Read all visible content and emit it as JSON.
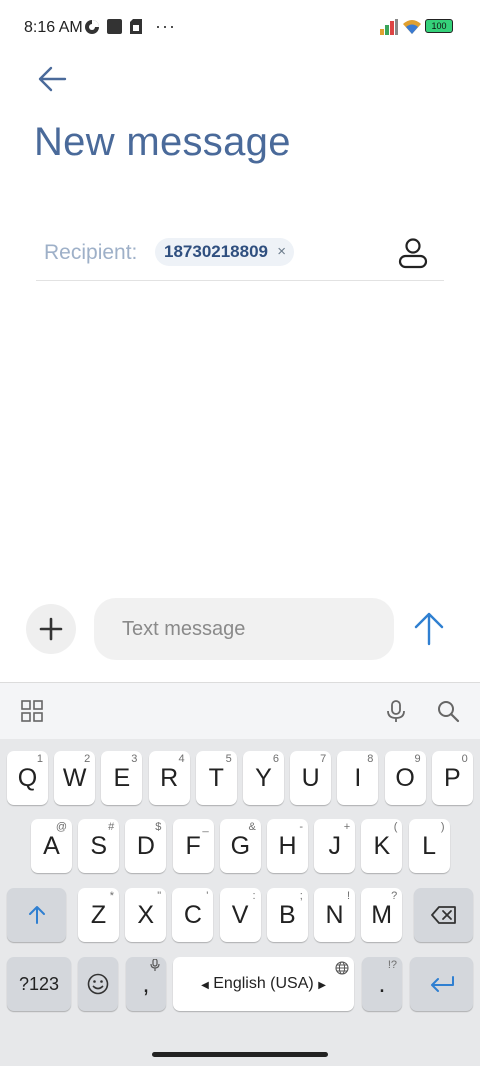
{
  "status_bar": {
    "time": "8:16 AM",
    "battery": "100",
    "more": "···"
  },
  "header": {
    "title": "New message"
  },
  "recipient": {
    "label": "Recipient:",
    "chip_value": "18730218809",
    "chip_remove": "×"
  },
  "compose": {
    "placeholder": "Text message"
  },
  "keyboard": {
    "row1": [
      {
        "label": "Q",
        "hint": "1"
      },
      {
        "label": "W",
        "hint": "2"
      },
      {
        "label": "E",
        "hint": "3"
      },
      {
        "label": "R",
        "hint": "4"
      },
      {
        "label": "T",
        "hint": "5"
      },
      {
        "label": "Y",
        "hint": "6"
      },
      {
        "label": "U",
        "hint": "7"
      },
      {
        "label": "I",
        "hint": "8"
      },
      {
        "label": "O",
        "hint": "9"
      },
      {
        "label": "P",
        "hint": "0"
      }
    ],
    "row2": [
      {
        "label": "A",
        "hint": "@"
      },
      {
        "label": "S",
        "hint": "#"
      },
      {
        "label": "D",
        "hint": "$"
      },
      {
        "label": "F",
        "hint": "_"
      },
      {
        "label": "G",
        "hint": "&"
      },
      {
        "label": "H",
        "hint": "-"
      },
      {
        "label": "J",
        "hint": "+"
      },
      {
        "label": "K",
        "hint": "("
      },
      {
        "label": "L",
        "hint": ")"
      }
    ],
    "row3": [
      {
        "label": "Z",
        "hint": "*"
      },
      {
        "label": "X",
        "hint": "\""
      },
      {
        "label": "C",
        "hint": "'"
      },
      {
        "label": "V",
        "hint": ":"
      },
      {
        "label": "B",
        "hint": ";"
      },
      {
        "label": "N",
        "hint": "!"
      },
      {
        "label": "M",
        "hint": "?"
      }
    ],
    "symbols_key": "?123",
    "comma": ",",
    "period": ".",
    "period_hint": "!?",
    "space_label": "English (USA)"
  },
  "colors": {
    "title": "#4a6a9a",
    "accent": "#2f7fd1"
  }
}
